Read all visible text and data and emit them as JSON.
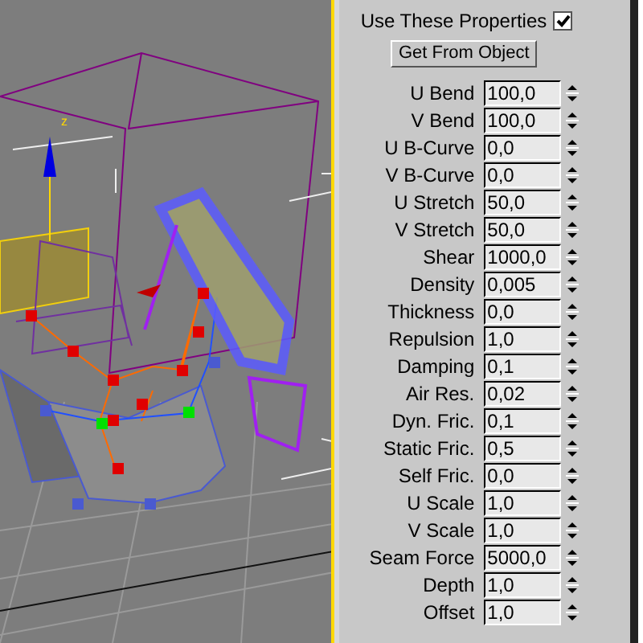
{
  "viewport": {
    "axis_label": "z"
  },
  "panel": {
    "use_properties": {
      "label": "Use These Properties",
      "checked": true
    },
    "get_button": "Get From Object",
    "fields": [
      {
        "label": "U Bend",
        "value": "100,0"
      },
      {
        "label": "V Bend",
        "value": "100,0"
      },
      {
        "label": "U B-Curve",
        "value": "0,0"
      },
      {
        "label": "V B-Curve",
        "value": "0,0"
      },
      {
        "label": "U Stretch",
        "value": "50,0"
      },
      {
        "label": "V Stretch",
        "value": "50,0"
      },
      {
        "label": "Shear",
        "value": "1000,0"
      },
      {
        "label": "Density",
        "value": "0,005"
      },
      {
        "label": "Thickness",
        "value": "0,0"
      },
      {
        "label": "Repulsion",
        "value": "1,0"
      },
      {
        "label": "Damping",
        "value": "0,1"
      },
      {
        "label": "Air Res.",
        "value": "0,02"
      },
      {
        "label": "Dyn. Fric.",
        "value": "0,1"
      },
      {
        "label": "Static Fric.",
        "value": "0,5"
      },
      {
        "label": "Self Fric.",
        "value": "0,0"
      },
      {
        "label": "U Scale",
        "value": "1,0"
      },
      {
        "label": "V Scale",
        "value": "1,0"
      },
      {
        "label": "Seam Force",
        "value": "5000,0"
      },
      {
        "label": "Depth",
        "value": "1,0"
      },
      {
        "label": "Offset",
        "value": "1,0"
      }
    ]
  }
}
